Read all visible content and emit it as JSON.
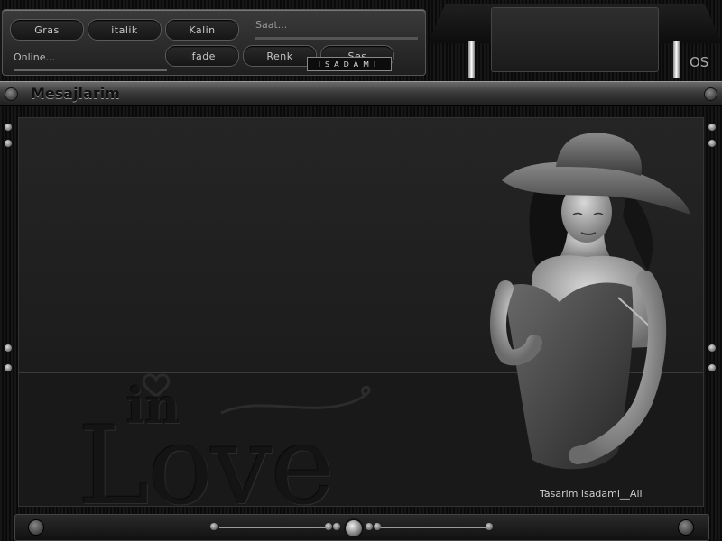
{
  "toolbar": {
    "gras": "Gras",
    "italik": "italik",
    "kalin": "Kalin",
    "ifade": "ifade",
    "renk": "Renk",
    "ses": "Ses"
  },
  "status": {
    "online": "Online...",
    "clock": "Saat..."
  },
  "brand": "ISADAMI",
  "corner_mark": "OS",
  "title": "Mesajlarim",
  "banner": {
    "in": "in",
    "love": "Love"
  },
  "credit": "Tasarim isadami__Ali",
  "colors": {
    "background": "#0d0d0d",
    "panel": "#2a2a2a",
    "text": "#c8c8c8"
  }
}
